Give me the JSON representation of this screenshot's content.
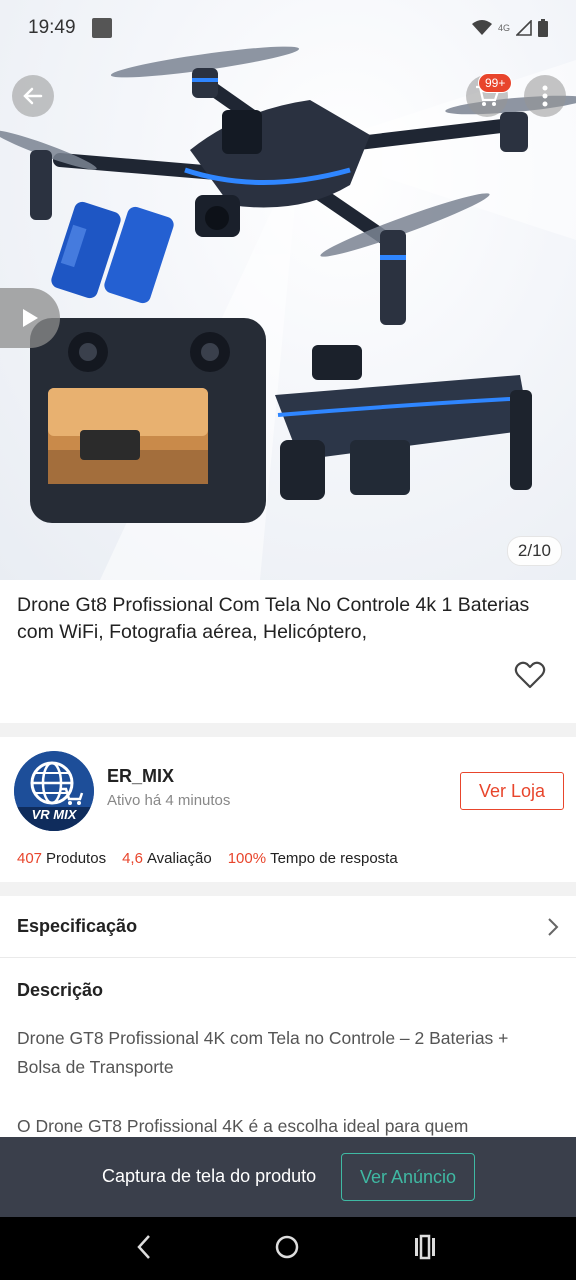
{
  "status_bar": {
    "time": "19:49",
    "network": "4G"
  },
  "product_image": {
    "counter": "2/10",
    "cart_badge": "99+"
  },
  "product": {
    "title": "Drone Gt8 Profissional Com Tela No Controle 4k 1 Baterias com WiFi, Fotografia aérea, Helicóptero,"
  },
  "shop": {
    "logo_text": "VR MIX",
    "name": "ER_MIX",
    "active": "Ativo há 4 minutos",
    "visit_button": "Ver Loja",
    "stats": [
      {
        "value": "407",
        "label": "Produtos"
      },
      {
        "value": "4,6",
        "label": "Avaliação"
      },
      {
        "value": "100%",
        "label": "Tempo de resposta"
      }
    ]
  },
  "spec": {
    "label": "Especificação"
  },
  "description": {
    "heading": "Descrição",
    "paragraph1": "Drone GT8 Profissional 4K com Tela no Controle – 2 Baterias + Bolsa de Transporte",
    "paragraph2": "O Drone GT8 Profissional 4K é a escolha ideal para quem"
  },
  "bottom_bar": {
    "label": "Captura de tela do produto",
    "button": "Ver Anúncio"
  },
  "colors": {
    "accent": "#e8452c",
    "teal": "#3fb9a3",
    "bar": "#3a3f4b"
  }
}
